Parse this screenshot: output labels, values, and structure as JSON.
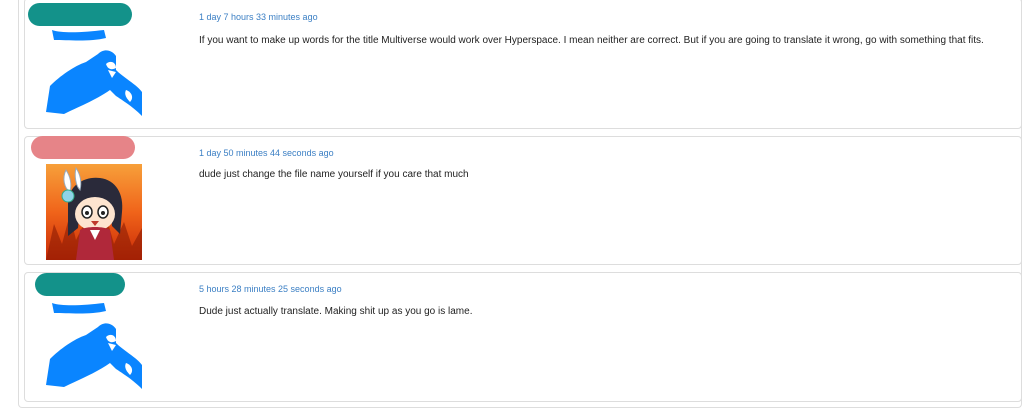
{
  "comments": [
    {
      "timestamp": "1 day 7 hours 33 minutes ago",
      "text": "If you want to make up words for the title Multiverse would work over Hyperspace. I mean neither are correct. But if you are going to translate it wrong, go with something that fits.",
      "name_pill_color": "#13928a",
      "avatar": "blue-figure-avatar"
    },
    {
      "timestamp": "1 day 50 minutes 44 seconds ago",
      "text": "dude just change the file name yourself if you care that much",
      "name_pill_color": "#e68488",
      "avatar": "anime-chibi-fire-avatar"
    },
    {
      "timestamp": "5 hours 28 minutes 25 seconds ago",
      "text": "Dude just actually translate. Making shit up as you go is lame.",
      "name_pill_color": "#13928a",
      "avatar": "blue-figure-avatar"
    }
  ],
  "colors": {
    "link": "#3b7fc4",
    "border": "#dddddd",
    "avatar_blue": "#0a85ff"
  }
}
